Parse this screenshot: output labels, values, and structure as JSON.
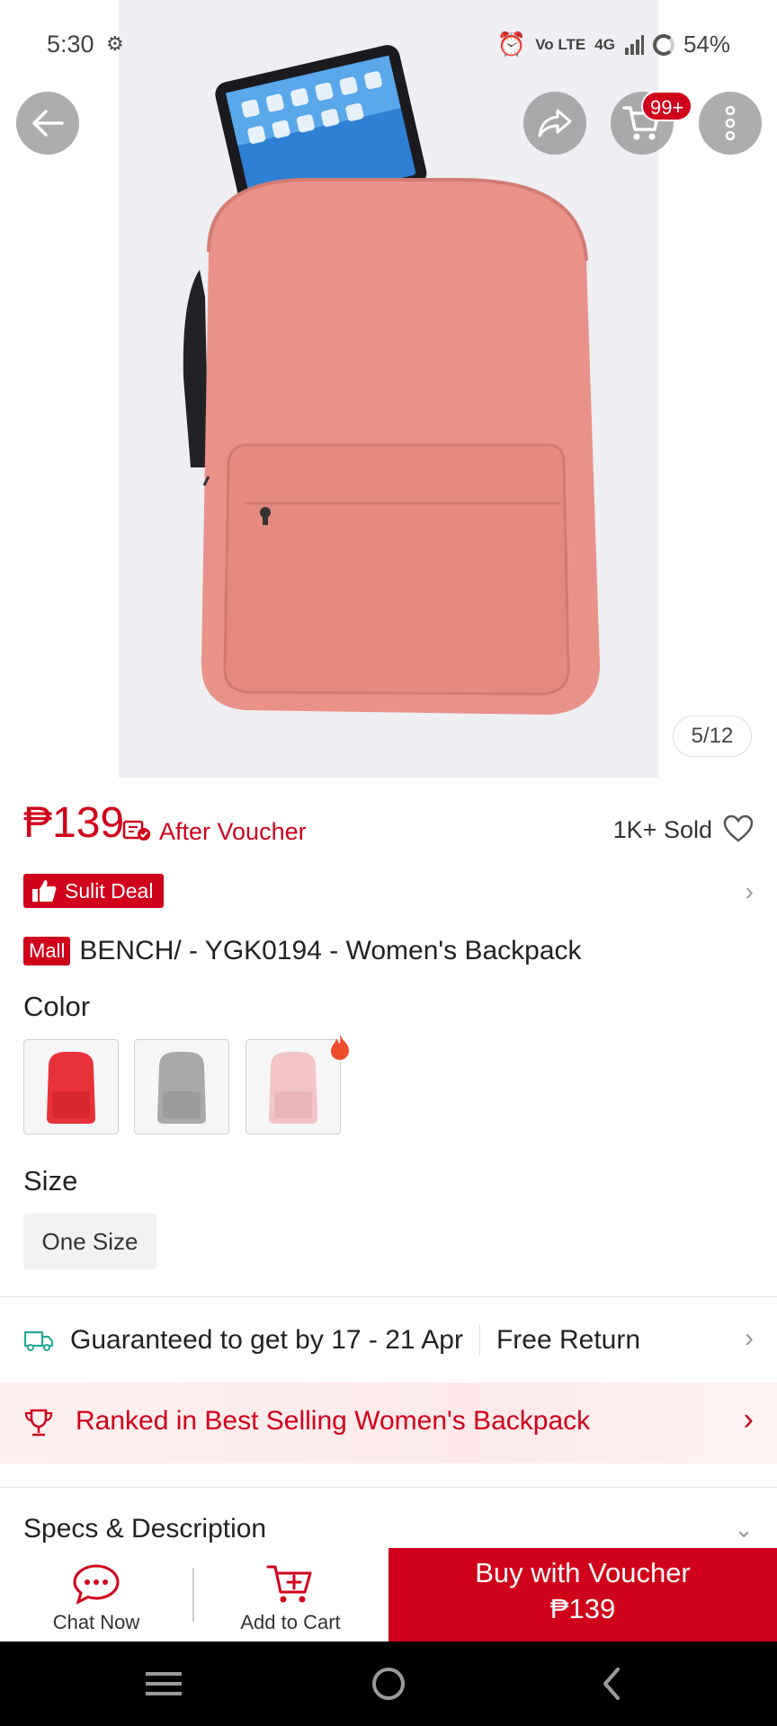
{
  "status": {
    "time": "5:30",
    "network": "4G",
    "volte": "Vo LTE",
    "battery": "54%"
  },
  "header": {
    "cart_badge": "99+",
    "image_counter": "5/12"
  },
  "product": {
    "price": "₱139",
    "after_voucher": "After Voucher",
    "sold": "1K+ Sold",
    "deal_label": "Sulit Deal",
    "mall_label": "Mall",
    "title": "BENCH/ - YGK0194 - Women's Backpack"
  },
  "variations": {
    "color_label": "Color",
    "colors": [
      {
        "name": "red",
        "hex": "#e8323a"
      },
      {
        "name": "gray",
        "hex": "#a9a9ab"
      },
      {
        "name": "pink",
        "hex": "#f2c4c6"
      }
    ],
    "size_label": "Size",
    "size_option": "One Size"
  },
  "shipping": {
    "guarantee": "Guaranteed to get by 17 - 21 Apr",
    "return": "Free Return"
  },
  "ranking": {
    "text": "Ranked in Best Selling Women's Backpack"
  },
  "specs": {
    "title": "Specs & Description"
  },
  "actions": {
    "chat": "Chat Now",
    "add_to_cart": "Add to Cart",
    "buy_line1": "Buy with Voucher",
    "buy_line2": "₱139"
  },
  "colors": {
    "brand": "#d0011b",
    "backpack": "#e99289"
  },
  "icons": {
    "back": "arrow-left-icon",
    "share": "share-icon",
    "cart": "cart-icon",
    "more": "more-vertical-icon",
    "heart": "heart-icon",
    "truck": "truck-icon",
    "trophy": "trophy-icon",
    "chat": "chat-icon",
    "add_cart": "cart-plus-icon"
  }
}
